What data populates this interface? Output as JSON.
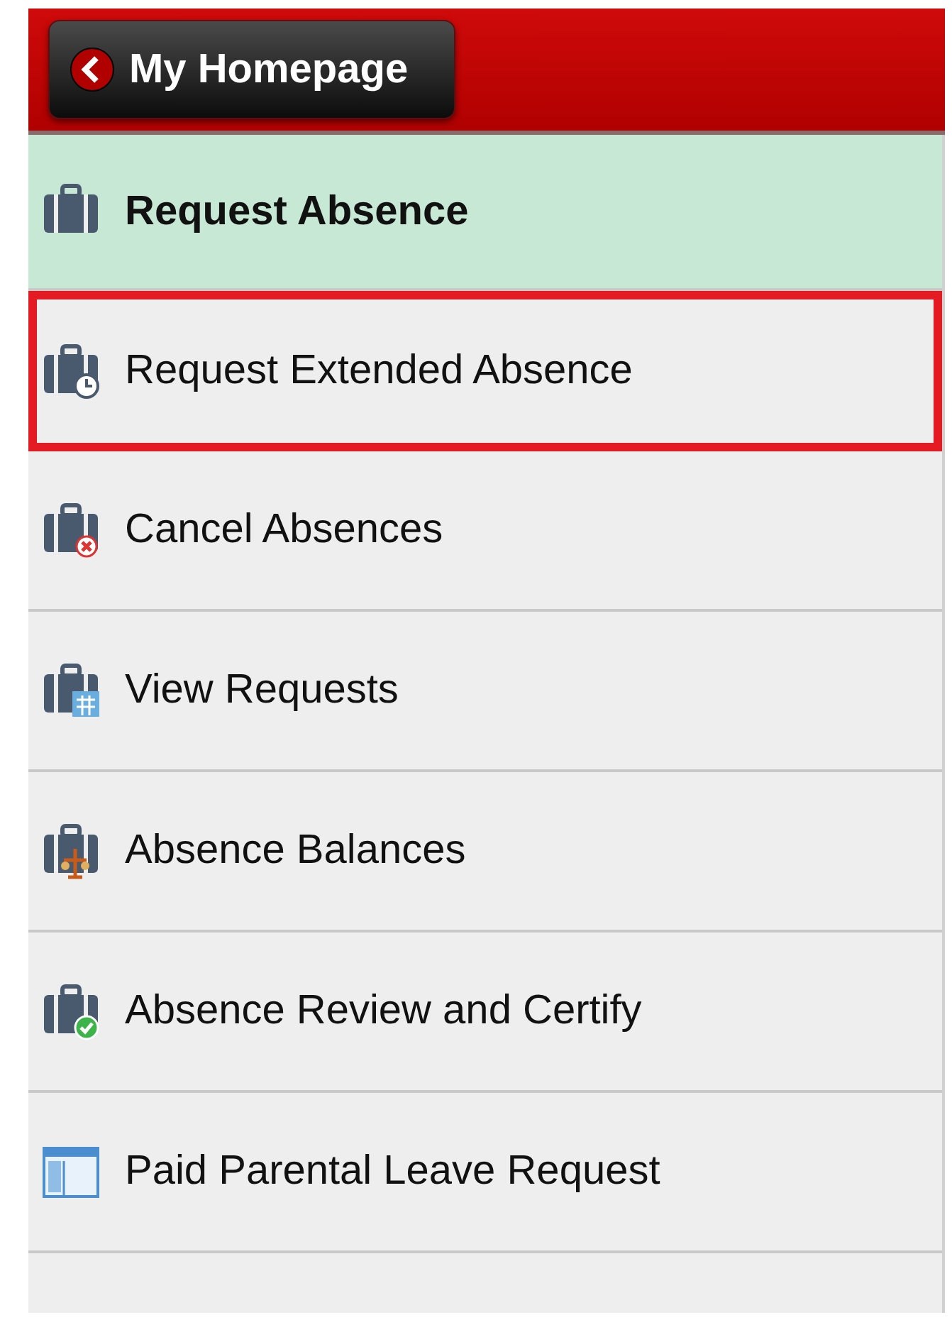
{
  "header": {
    "back_button": {
      "label": "My Homepage"
    }
  },
  "menu": [
    {
      "label": "Request Absence",
      "kind": "plain",
      "selected": true,
      "highlighted": false
    },
    {
      "label": "Request Extended Absence",
      "kind": "clock",
      "selected": false,
      "highlighted": true
    },
    {
      "label": "Cancel Absences",
      "kind": "cancel",
      "selected": false,
      "highlighted": false
    },
    {
      "label": "View Requests",
      "kind": "calendar",
      "selected": false,
      "highlighted": false
    },
    {
      "label": "Absence Balances",
      "kind": "scale",
      "selected": false,
      "highlighted": false
    },
    {
      "label": "Absence Review and Certify",
      "kind": "check",
      "selected": false,
      "highlighted": false
    },
    {
      "label": "Paid Parental Leave Request",
      "kind": "form",
      "selected": false,
      "highlighted": false
    }
  ]
}
